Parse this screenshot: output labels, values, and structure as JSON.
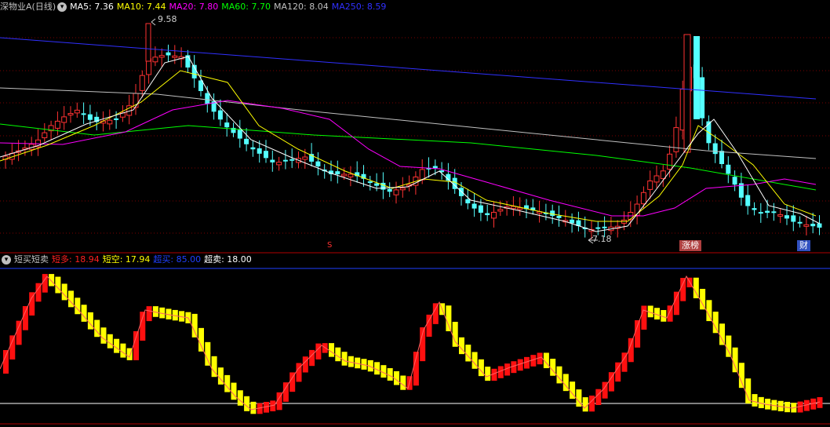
{
  "main_legend": {
    "stock_name": "深物业A(日线)",
    "items": [
      {
        "label": "MA5: 7.36",
        "color": "#ffffff"
      },
      {
        "label": "MA10: 7.44",
        "color": "#ffff00"
      },
      {
        "label": "MA20: 7.80",
        "color": "#ff00ff"
      },
      {
        "label": "MA60: 7.70",
        "color": "#00ff00"
      },
      {
        "label": "MA120: 8.04",
        "color": "#c0c0c0"
      },
      {
        "label": "MA250: 8.59",
        "color": "#3030ff"
      }
    ]
  },
  "annotations": {
    "high_price": "9.58",
    "low_price": "7.18",
    "mark_s": "S",
    "mark_zhangbang": "涨榜",
    "mark_cai": "财"
  },
  "indicator_legend": {
    "name": "短买短卖",
    "items": [
      {
        "label": "短多: 18.94",
        "color": "#ff2020"
      },
      {
        "label": "短空: 17.94",
        "color": "#ffff00"
      },
      {
        "label": "超买: 85.00",
        "color": "#2040ff"
      },
      {
        "label": "超卖: 18.00",
        "color": "#ffffff"
      }
    ]
  },
  "colors": {
    "up": "#ff3232",
    "down": "#54ffff",
    "bull": "#ff1010",
    "bear": "#ffff00",
    "grid": "#7a0000",
    "divider": "#b00000"
  },
  "chart_data": {
    "type": "candlestick",
    "series": [
      {
        "name": "MA5"
      },
      {
        "name": "MA10"
      },
      {
        "name": "MA20"
      },
      {
        "name": "MA60"
      },
      {
        "name": "MA120"
      },
      {
        "name": "MA250"
      }
    ],
    "high_marker": 9.58,
    "low_marker": 7.18,
    "indicator": {
      "name": "短买短卖",
      "overbought": 85,
      "oversold": 18
    }
  }
}
